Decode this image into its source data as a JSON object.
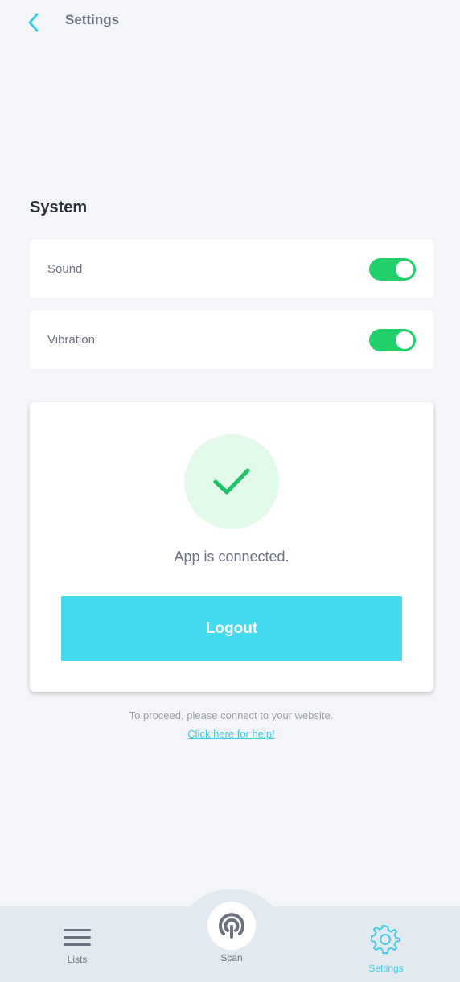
{
  "header": {
    "title": "Settings",
    "back_icon": "chevron-left-icon"
  },
  "system": {
    "title": "System",
    "settings": [
      {
        "label": "Sound",
        "enabled": true
      },
      {
        "label": "Vibration",
        "enabled": true
      }
    ]
  },
  "connection": {
    "status_icon": "check-icon",
    "status_text": "App is connected.",
    "logout_label": "Logout",
    "hint": "To proceed, please connect to your website.",
    "help_link": "Click here for help!"
  },
  "nav": {
    "lists_label": "Lists",
    "scan_label": "Scan",
    "settings_label": "Settings",
    "active": "Settings"
  },
  "colors": {
    "accent": "#43d9ef",
    "toggle_on": "#22d06a",
    "success_bg": "#e3faea",
    "background": "#f3f5f8",
    "nav_background": "#e3e9f0"
  }
}
